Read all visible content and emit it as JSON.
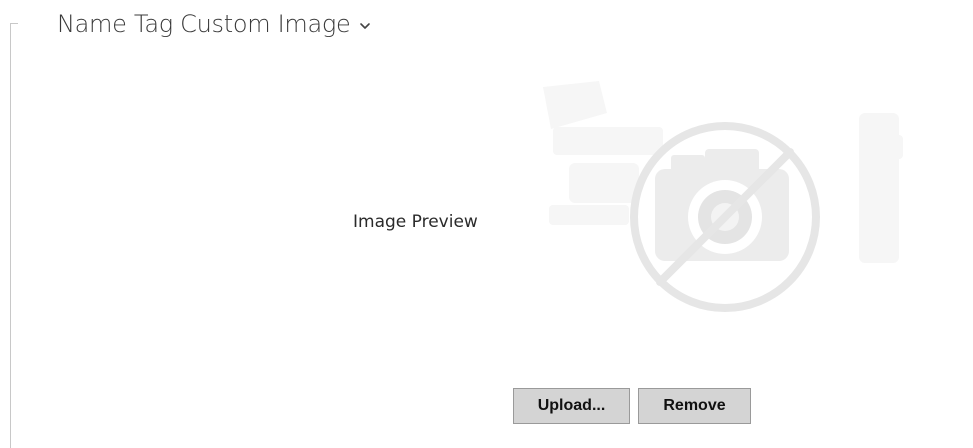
{
  "section": {
    "title": "Name Tag Custom Image",
    "expand_icon": "chevron-down-icon"
  },
  "preview": {
    "label": "Image Preview",
    "placeholder_icon": "no-camera-icon"
  },
  "actions": {
    "upload_label": "Upload...",
    "remove_label": "Remove"
  }
}
